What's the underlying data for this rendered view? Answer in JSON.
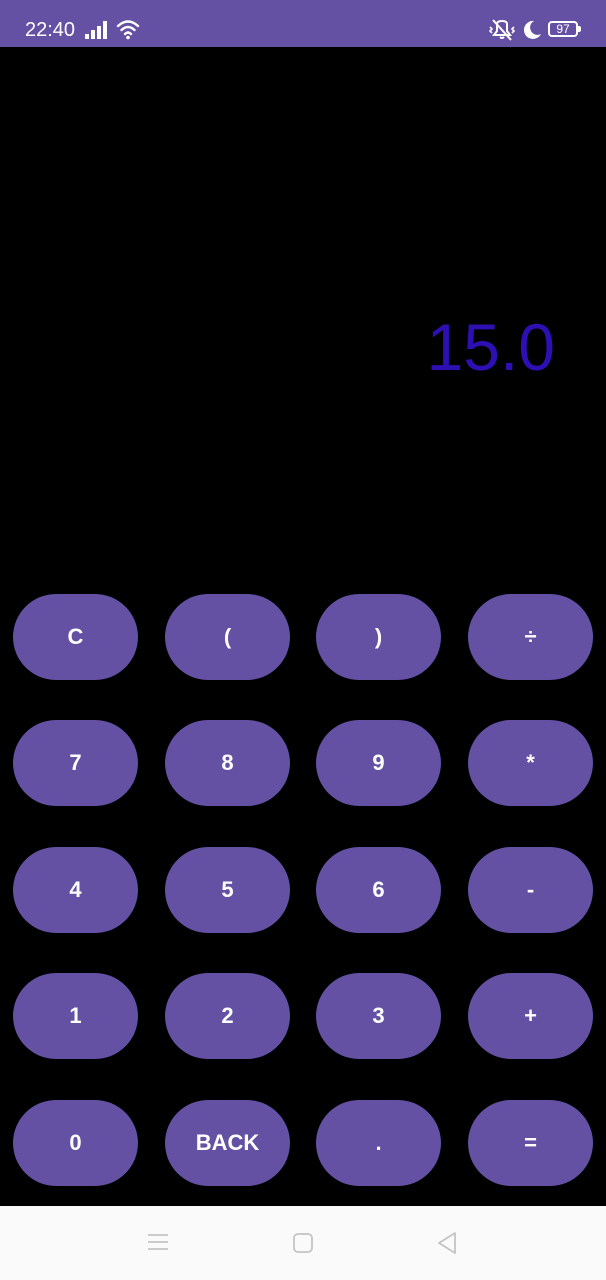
{
  "status_bar": {
    "time": "22:40",
    "battery_level": "97",
    "icons": [
      "signal-icon",
      "wifi-icon",
      "mute-vibrate-icon",
      "moon-icon",
      "battery-icon"
    ],
    "background_color": "#6551a4"
  },
  "display": {
    "value": "15.0",
    "text_color": "#2e0fb3"
  },
  "keypad": {
    "button_color": "#6451a4",
    "rows": [
      [
        "C",
        "(",
        ")",
        "÷"
      ],
      [
        "7",
        "8",
        "9",
        "*"
      ],
      [
        "4",
        "5",
        "6",
        "-"
      ],
      [
        "1",
        "2",
        "3",
        "+"
      ],
      [
        "0",
        "BACK",
        ".",
        "="
      ]
    ]
  },
  "nav_bar": {
    "icons": [
      "menu-icon",
      "home-icon",
      "back-icon"
    ]
  }
}
